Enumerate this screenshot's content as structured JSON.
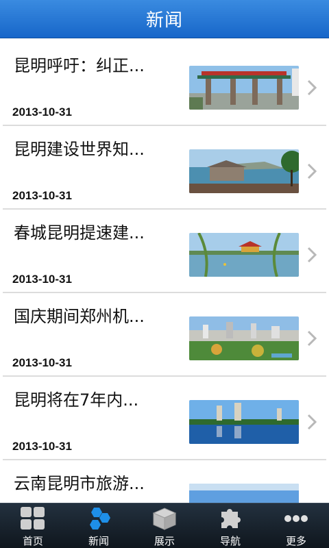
{
  "header": {
    "title": "新闻"
  },
  "news": [
    {
      "title": "昆明呼吁：纠正...",
      "date": "2013-10-31",
      "image": "city-gate-photo"
    },
    {
      "title": "昆明建设世界知...",
      "date": "2013-10-31",
      "image": "lakeside-pavilion-photo"
    },
    {
      "title": "春城昆明提速建...",
      "date": "2013-10-31",
      "image": "lake-temple-photo"
    },
    {
      "title": "国庆期间郑州机...",
      "date": "2013-10-31",
      "image": "city-skyline-photo"
    },
    {
      "title": "昆明将在7年内...",
      "date": "2013-10-31",
      "image": "pagoda-reflection-photo"
    },
    {
      "title": "云南昆明市旅游...",
      "date": "",
      "image": "sky-photo"
    }
  ],
  "tabbar": {
    "items": [
      {
        "label": "首页",
        "icon": "home-grid-icon"
      },
      {
        "label": "新闻",
        "icon": "news-hexagon-icon",
        "active": true
      },
      {
        "label": "展示",
        "icon": "box-icon"
      },
      {
        "label": "导航",
        "icon": "puzzle-icon"
      },
      {
        "label": "更多",
        "icon": "more-dots-icon"
      }
    ]
  },
  "colors": {
    "header": "#1f6fd0",
    "tabbar": "#17212b",
    "active_icon": "#1e8fe8"
  }
}
